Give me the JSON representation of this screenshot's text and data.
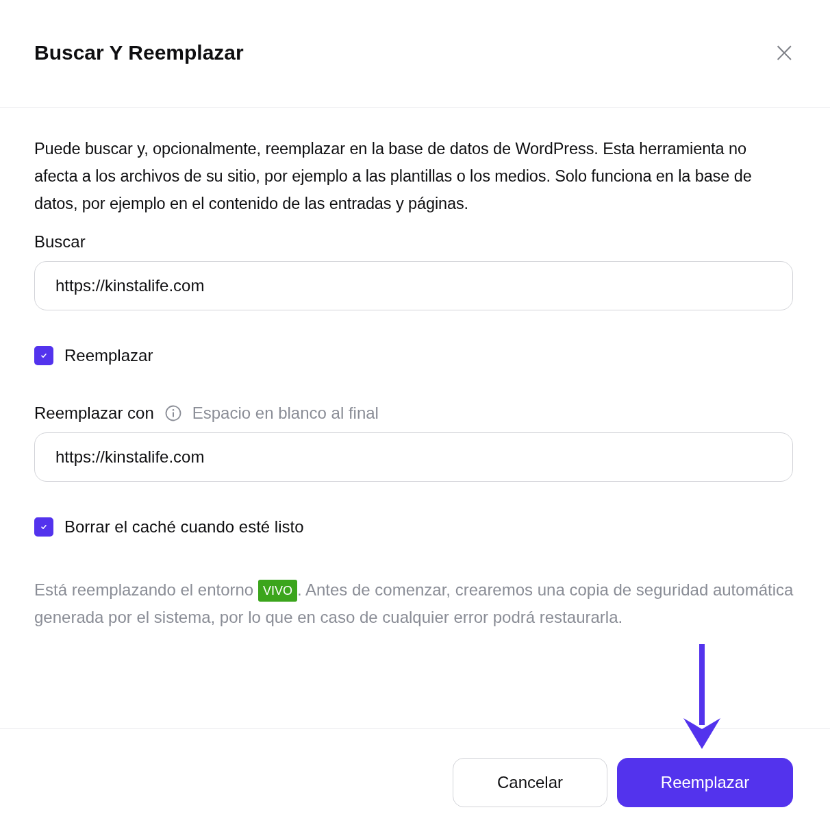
{
  "dialog": {
    "title": "Buscar Y Reemplazar",
    "close": "×"
  },
  "description": "Puede buscar y, opcionalmente, reemplazar en la base de datos de WordPress. Esta herramienta no afecta a los archivos de su sitio, por ejemplo a las plantillas o los medios. Solo funciona en la base de datos, por ejemplo en el contenido de las entradas y páginas.",
  "search": {
    "label": "Buscar",
    "value": "https://kinstalife.com"
  },
  "replace_checkbox": {
    "label": "Reemplazar",
    "checked": true
  },
  "replace_with": {
    "label": "Reemplazar con",
    "hint": "Espacio en blanco al final",
    "value": "https://kinstalife.com"
  },
  "clear_cache_checkbox": {
    "label": "Borrar el caché cuando esté listo",
    "checked": true
  },
  "note": {
    "before": "Está reemplazando el entorno",
    "badge": {
      "label": "VIVO",
      "color": "#3ba51c"
    },
    "after": ". Antes de comenzar, crearemos una copia de seguridad automática generada por el sistema, por lo que en caso de cualquier error podrá restaurarla."
  },
  "buttons": [
    {
      "label": "Cancelar",
      "kind": "secondary"
    },
    {
      "label": "Reemplazar",
      "kind": "primary"
    }
  ]
}
